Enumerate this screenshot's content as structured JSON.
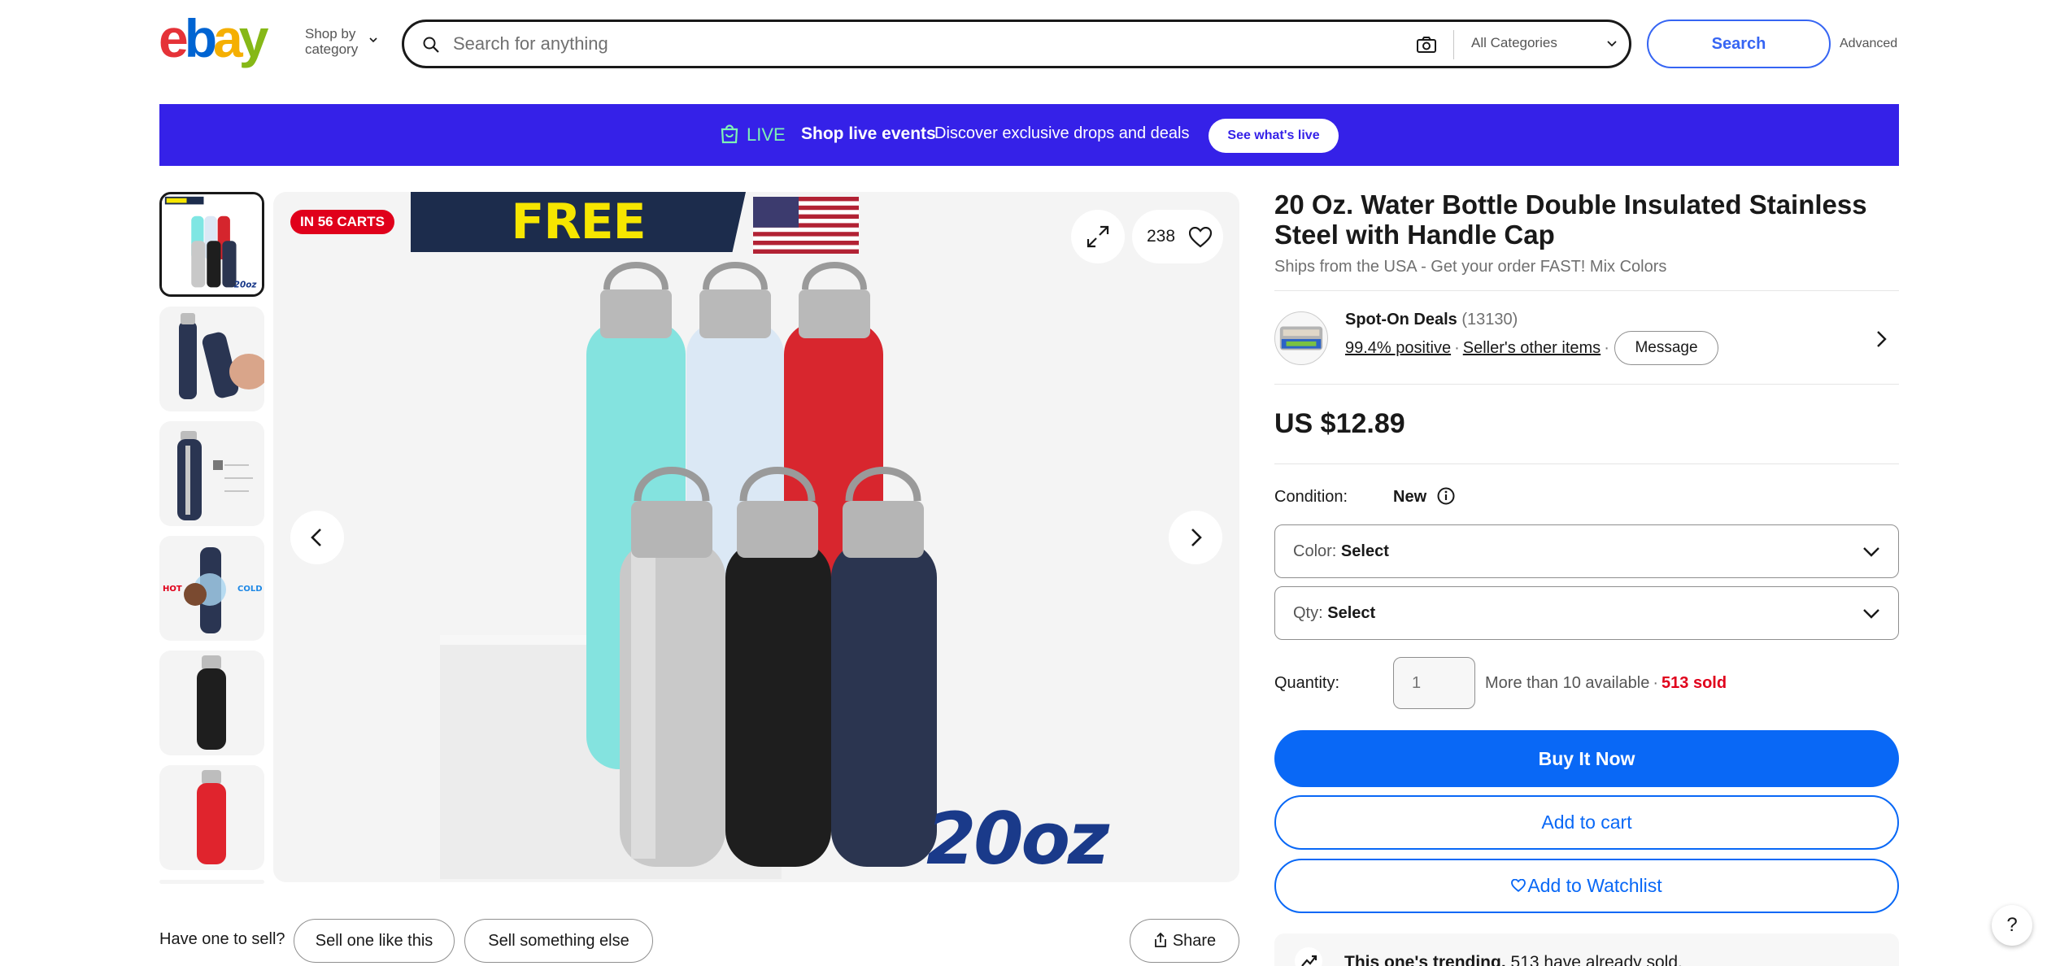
{
  "header": {
    "logo_text": "ebay",
    "shop_by_line1": "Shop by",
    "shop_by_line2": "category",
    "search_placeholder": "Search for anything",
    "category_select": "All Categories",
    "search_button": "Search",
    "advanced_link": "Advanced"
  },
  "live_banner": {
    "live_label": "LIVE",
    "events_label": "Shop live events",
    "tagline": "Discover exclusive drops and deals",
    "cta": "See what's live",
    "bg_color": "#3521e8"
  },
  "gallery": {
    "carts_badge": "IN 56 CARTS",
    "free_shipping_text": "FREE SHIPPING",
    "size_text": "20oz",
    "watch_count": "238",
    "thumbnails": [
      {
        "name": "thumb-bottles-group",
        "selected": true
      },
      {
        "name": "thumb-navy-in-hand",
        "selected": false
      },
      {
        "name": "thumb-navy-diagram",
        "selected": false
      },
      {
        "name": "thumb-hot-cold",
        "selected": false
      },
      {
        "name": "thumb-black-bottle",
        "selected": false
      },
      {
        "name": "thumb-red-bottle",
        "selected": false
      }
    ]
  },
  "sell_row": {
    "label": "Have one to sell?",
    "sell_like": "Sell one like this",
    "sell_other": "Sell something else",
    "share": "Share"
  },
  "listing": {
    "title": "20 Oz. Water Bottle Double Insulated Stainless Steel with Handle Cap",
    "subtitle": "Ships from the USA - Get your order FAST! Mix Colors",
    "seller": {
      "name": "Spot-On Deals",
      "feedback_count": "(13130)",
      "positive": "99.4% positive",
      "other_items": "Seller's other items",
      "message": "Message"
    },
    "price": "US $12.89",
    "condition_label": "Condition:",
    "condition_value": "New",
    "color_label": "Color:",
    "color_value": "Select",
    "qty_select_label": "Qty:",
    "qty_select_value": "Select",
    "quantity_label": "Quantity:",
    "quantity_placeholder": "1",
    "availability": "More than 10 available",
    "sold": "513 sold",
    "buy_now": "Buy It Now",
    "add_to_cart": "Add to cart",
    "add_to_watchlist": "Add to Watchlist",
    "promo_bold": "This one's trending.",
    "promo_rest": "513 have already sold."
  },
  "colors": {
    "brand_blue": "#0968f6",
    "sold_red": "#e0001b",
    "live_green": "#7ef2b4"
  }
}
